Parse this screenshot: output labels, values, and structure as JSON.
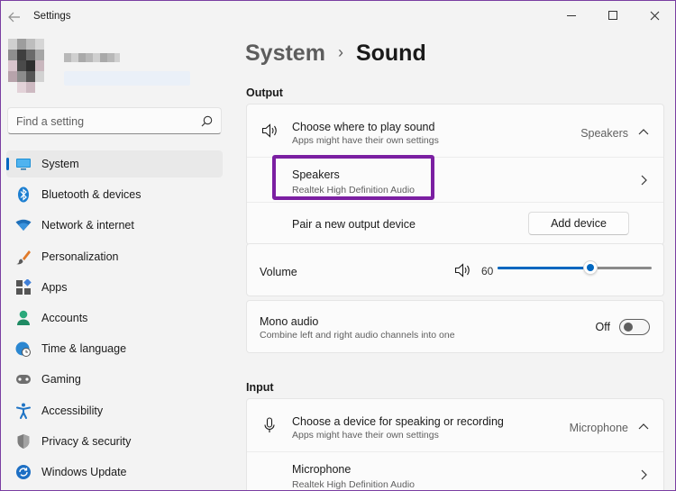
{
  "window": {
    "title": "Settings"
  },
  "search": {
    "placeholder": "Find a setting"
  },
  "sidebar": {
    "items": [
      {
        "label": "System",
        "icon": "system-display-icon",
        "active": true
      },
      {
        "label": "Bluetooth & devices",
        "icon": "bluetooth-icon"
      },
      {
        "label": "Network & internet",
        "icon": "wifi-icon"
      },
      {
        "label": "Personalization",
        "icon": "brush-icon"
      },
      {
        "label": "Apps",
        "icon": "apps-icon"
      },
      {
        "label": "Accounts",
        "icon": "person-icon"
      },
      {
        "label": "Time & language",
        "icon": "globe-clock-icon"
      },
      {
        "label": "Gaming",
        "icon": "gamepad-icon"
      },
      {
        "label": "Accessibility",
        "icon": "accessibility-icon"
      },
      {
        "label": "Privacy & security",
        "icon": "shield-icon"
      },
      {
        "label": "Windows Update",
        "icon": "windows-update-icon"
      }
    ]
  },
  "breadcrumb": {
    "parent": "System",
    "separator": "›",
    "current": "Sound"
  },
  "output": {
    "section_title": "Output",
    "choose": {
      "title": "Choose where to play sound",
      "subtitle": "Apps might have their own settings",
      "value": "Speakers"
    },
    "device": {
      "title": "Speakers",
      "subtitle": "Realtek High Definition Audio"
    },
    "pair": {
      "title": "Pair a new output device",
      "button": "Add device"
    },
    "volume": {
      "label": "Volume",
      "value": "60",
      "level": 0.6
    },
    "mono": {
      "title": "Mono audio",
      "subtitle": "Combine left and right audio channels into one",
      "state": "Off"
    }
  },
  "input": {
    "section_title": "Input",
    "choose": {
      "title": "Choose a device for speaking or recording",
      "subtitle": "Apps might have their own settings",
      "value": "Microphone"
    },
    "device": {
      "title": "Microphone",
      "subtitle": "Realtek High Definition Audio"
    }
  },
  "colors": {
    "accent": "#0067c0",
    "highlight_box": "#7b1fa2"
  }
}
